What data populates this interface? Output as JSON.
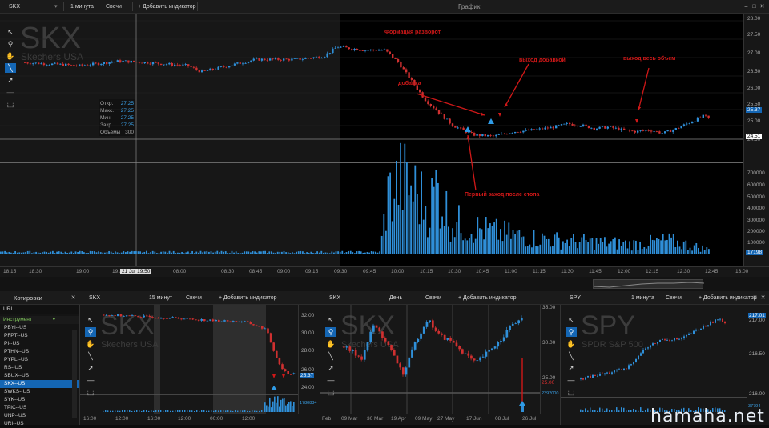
{
  "main": {
    "symbol": "SKX",
    "interval": "1 минута",
    "style": "Свечи",
    "add_indicator": "+ Добавить индикатор",
    "window_title": "График",
    "ghost_ticker": "SKX",
    "ghost_name": "Skechers USA",
    "ohlc": {
      "open_l": "Откр.",
      "open": "27.25",
      "high_l": "Макс.",
      "high": "27.25",
      "low_l": "Мин.",
      "low": "27.25",
      "close_l": "Закр.",
      "close": "27.25",
      "vol_l": "Объемы",
      "vol": "300"
    },
    "price_axis": [
      "28.00",
      "27.50",
      "27.00",
      "26.50",
      "26.00",
      "25.50",
      "25.00",
      "24.50"
    ],
    "price_tag": "25.37",
    "cross_price": "24.51",
    "vol_axis": [
      "700000",
      "600000",
      "500000",
      "400000",
      "300000",
      "200000",
      "100000"
    ],
    "vol_tag": "17198",
    "time_axis": [
      "18:15",
      "18:30",
      "19:00",
      "19:30",
      "21 Jul 19:50",
      "08:00",
      "08:30",
      "08:45",
      "09:00",
      "09:15",
      "09:30",
      "09:45",
      "10:00",
      "10:15",
      "10:30",
      "10:45",
      "11:00",
      "11:15",
      "11:30",
      "11:45",
      "12:00",
      "12:15",
      "12:30",
      "12:45",
      "13:00"
    ],
    "annotations": {
      "a1": "Формация разворот.",
      "a2": "выход добавкой",
      "a3": "выход весь объем",
      "a4": "добавка",
      "a5": "Первый заход после стопа"
    },
    "chart_data": {
      "type": "candlestick",
      "ylim": [
        24.3,
        28.2
      ],
      "close_anchors": [
        [
          0,
          27.2
        ],
        [
          8,
          27.1
        ],
        [
          14,
          27.25
        ],
        [
          18,
          27.2
        ],
        [
          24,
          27.1
        ],
        [
          26,
          26.9
        ],
        [
          28,
          27.0
        ],
        [
          34,
          27.3
        ],
        [
          40,
          27.3
        ],
        [
          44,
          27.4
        ],
        [
          46,
          27.7
        ],
        [
          50,
          27.6
        ],
        [
          53,
          27.6
        ],
        [
          55,
          27.2
        ],
        [
          57,
          26.6
        ],
        [
          59,
          26.0
        ],
        [
          61,
          25.6
        ],
        [
          63,
          25.2
        ],
        [
          66,
          24.9
        ],
        [
          69,
          24.85
        ],
        [
          72,
          25.0
        ],
        [
          75,
          25.05
        ],
        [
          78,
          25.15
        ],
        [
          80,
          25.25
        ],
        [
          82,
          25.2
        ],
        [
          84,
          25.1
        ],
        [
          86,
          25.15
        ],
        [
          88,
          25.05
        ],
        [
          90,
          25.0
        ],
        [
          92,
          25.05
        ],
        [
          94,
          24.95
        ],
        [
          96,
          25.1
        ],
        [
          98,
          25.3
        ],
        [
          100,
          25.5
        ],
        [
          101,
          25.4
        ]
      ],
      "volume_ylim": [
        0,
        780000
      ],
      "volume_shape": [
        [
          0,
          20000
        ],
        [
          54,
          20000
        ],
        [
          55,
          500000
        ],
        [
          57,
          650000
        ],
        [
          59,
          550000
        ],
        [
          61,
          400000
        ],
        [
          62,
          600000
        ],
        [
          64,
          300000
        ],
        [
          66,
          250000
        ],
        [
          70,
          200000
        ],
        [
          75,
          150000
        ],
        [
          80,
          120000
        ],
        [
          90,
          90000
        ],
        [
          95,
          120000
        ],
        [
          101,
          40000
        ]
      ]
    }
  },
  "quotes": {
    "title": "Котировки",
    "search": "URI",
    "header": "Инструмент",
    "items": [
      "PBYI--US",
      "PFPT--US",
      "PI--US",
      "PTHN--US",
      "PYPL--US",
      "RS--US",
      "SBUX--US",
      "SKX--US",
      "SWKS--US",
      "SYK--US",
      "TPIC--US",
      "UNP--US",
      "URI--US"
    ],
    "selected": 7
  },
  "sub1": {
    "symbol": "SKX",
    "interval": "15 минут",
    "style": "Свечи",
    "add_indicator": "+ Добавить индикатор",
    "ghost_ticker": "SKX",
    "ghost_name": "Skechers USA",
    "price_axis": [
      "32.00",
      "30.00",
      "28.00",
      "26.00",
      "24.00"
    ],
    "tags": [
      "25.37",
      "1780834"
    ],
    "time_axis": [
      "16:00",
      "12:00",
      "16:00",
      "12:00",
      "00:00",
      "12:00"
    ],
    "chart_data": {
      "type": "candlestick",
      "ylim": [
        23,
        33
      ],
      "close_anchors": [
        [
          0,
          32.2
        ],
        [
          10,
          32.0
        ],
        [
          20,
          31.8
        ],
        [
          30,
          31.5
        ],
        [
          38,
          31.4
        ],
        [
          44,
          30.5
        ],
        [
          46,
          28.0
        ],
        [
          48,
          26.0
        ],
        [
          50,
          25.2
        ],
        [
          52,
          25.4
        ]
      ]
    }
  },
  "sub2": {
    "symbol": "SKX",
    "interval": "День",
    "style": "Свечи",
    "add_indicator": "+ Добавить индикатор",
    "ghost_ticker": "SKX",
    "ghost_name": "Skechers USA",
    "price_axis": [
      "35.00",
      "30.00",
      "25.00",
      "2392000"
    ],
    "tags": [
      "25.00"
    ],
    "time_axis": [
      "Feb",
      "09 Mar",
      "30 Mar",
      "19 Apr",
      "09 May",
      "27 May",
      "17 Jun",
      "08 Jul",
      "26 Jul"
    ],
    "chart_data": {
      "type": "candlestick",
      "ylim": [
        21,
        36
      ],
      "close_anchors": [
        [
          0,
          29
        ],
        [
          6,
          27
        ],
        [
          10,
          33
        ],
        [
          14,
          30
        ],
        [
          17,
          27
        ],
        [
          20,
          24
        ],
        [
          24,
          30
        ],
        [
          28,
          34
        ],
        [
          32,
          31
        ],
        [
          36,
          30
        ],
        [
          40,
          28
        ],
        [
          44,
          26
        ],
        [
          48,
          28
        ],
        [
          52,
          30
        ],
        [
          56,
          33
        ],
        [
          60,
          34
        ]
      ]
    }
  },
  "sub3": {
    "symbol": "SPY",
    "interval": "1 минута",
    "style": "Свечи",
    "add_indicator": "+ Добавить индикатор",
    "ghost_ticker": "SPY",
    "ghost_name": "SPDR S&P 500",
    "price_axis": [
      "217.00",
      "216.50",
      "216.00"
    ],
    "tags": [
      "217.01",
      "37794"
    ],
    "chart_data": {
      "type": "candlestick",
      "ylim": [
        215.6,
        217.2
      ],
      "close_anchors": [
        [
          0,
          215.8
        ],
        [
          5,
          215.9
        ],
        [
          10,
          216.0
        ],
        [
          14,
          216.4
        ],
        [
          18,
          216.6
        ],
        [
          22,
          216.6
        ],
        [
          26,
          216.8
        ],
        [
          30,
          217.0
        ],
        [
          32,
          216.95
        ]
      ]
    }
  },
  "watermark": "hamaha.net"
}
